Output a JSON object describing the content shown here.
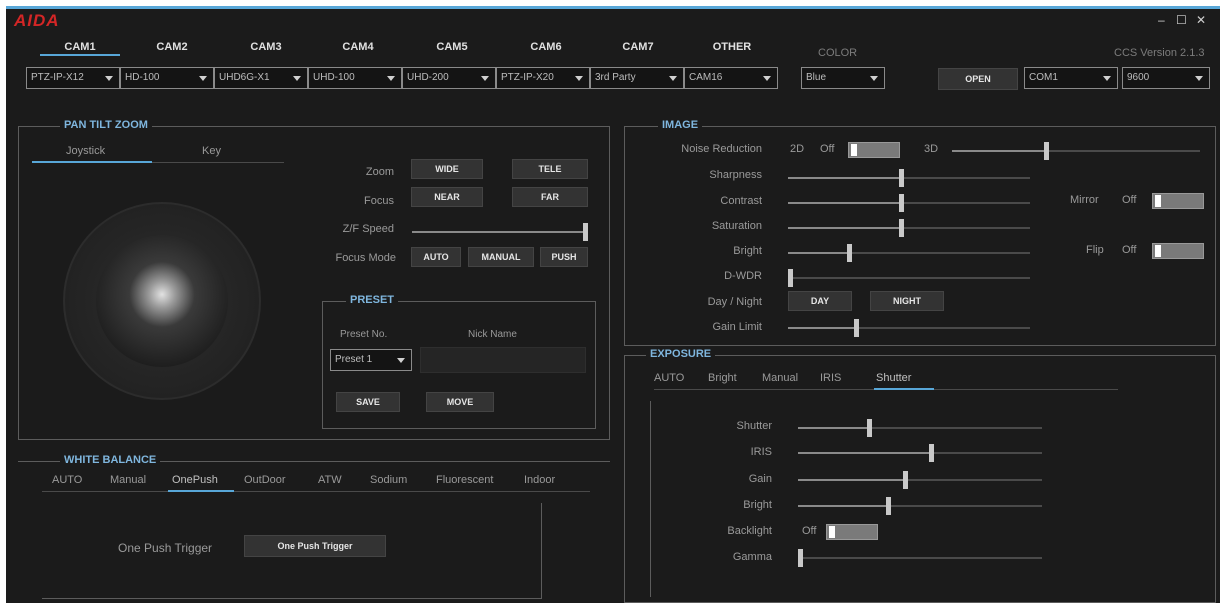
{
  "app": {
    "logo": "AIDA",
    "version": "CCS Version 2.1.3",
    "window_controls": [
      "–",
      "☐",
      "✕"
    ]
  },
  "cameras": {
    "tabs": [
      "CAM1",
      "CAM2",
      "CAM3",
      "CAM4",
      "CAM5",
      "CAM6",
      "CAM7",
      "OTHER"
    ],
    "models": [
      "PTZ-IP-X12",
      "HD-100",
      "UHD6G-X1",
      "UHD-100",
      "UHD-200",
      "PTZ-IP-X20",
      "3rd Party",
      "CAM16"
    ]
  },
  "color": {
    "label": "COLOR",
    "value": "Blue"
  },
  "connection": {
    "open_label": "OPEN",
    "port": "COM1",
    "baud": "9600"
  },
  "ptz": {
    "title": "PAN TILT ZOOM",
    "tabs": [
      "Joystick",
      "Key"
    ],
    "zoom_label": "Zoom",
    "wide": "WIDE",
    "tele": "TELE",
    "focus_label": "Focus",
    "near": "NEAR",
    "far": "FAR",
    "zf_speed_label": "Z/F Speed",
    "zf_speed": 1.0,
    "focus_mode_label": "Focus Mode",
    "auto": "AUTO",
    "manual": "MANUAL",
    "push": "PUSH"
  },
  "preset": {
    "title": "PRESET",
    "preset_no_label": "Preset No.",
    "nick_name_label": "Nick Name",
    "preset_value": "Preset 1",
    "save": "SAVE",
    "move": "MOVE"
  },
  "white_balance": {
    "title": "WHITE BALANCE",
    "tabs": [
      "AUTO",
      "Manual",
      "OnePush",
      "OutDoor",
      "ATW",
      "Sodium",
      "Fluorescent",
      "Indoor"
    ],
    "active_tab": "OnePush",
    "trigger_label": "One Push Trigger",
    "trigger_button": "One Push Trigger"
  },
  "image": {
    "title": "IMAGE",
    "noise_reduction_label": "Noise Reduction",
    "nr_2d_label": "2D",
    "nr_2d_state": "Off",
    "nr_3d_label": "3D",
    "nr_3d": 0.38,
    "sharpness_label": "Sharpness",
    "sharpness": 0.47,
    "contrast_label": "Contrast",
    "contrast": 0.47,
    "saturation_label": "Saturation",
    "saturation": 0.47,
    "bright_label": "Bright",
    "bright": 0.25,
    "dwdr_label": "D-WDR",
    "dwdr": 0.0,
    "day_night_label": "Day / Night",
    "day": "DAY",
    "night": "NIGHT",
    "gain_limit_label": "Gain Limit",
    "gain_limit": 0.28,
    "mirror_label": "Mirror",
    "mirror_state": "Off",
    "flip_label": "Flip",
    "flip_state": "Off"
  },
  "exposure": {
    "title": "EXPOSURE",
    "tabs": [
      "AUTO",
      "Bright",
      "Manual",
      "IRIS",
      "Shutter"
    ],
    "active_tab": "Shutter",
    "shutter_label": "Shutter",
    "shutter": 0.29,
    "iris_label": "IRIS",
    "iris": 0.55,
    "gain_label": "Gain",
    "gain": 0.44,
    "bright_label": "Bright",
    "bright": 0.37,
    "backlight_label": "Backlight",
    "backlight_state": "Off",
    "gamma_label": "Gamma",
    "gamma": 0.0
  },
  "colors": {
    "accent": "#58a7d8",
    "logo": "#d32626",
    "background": "#1b1b1b"
  }
}
